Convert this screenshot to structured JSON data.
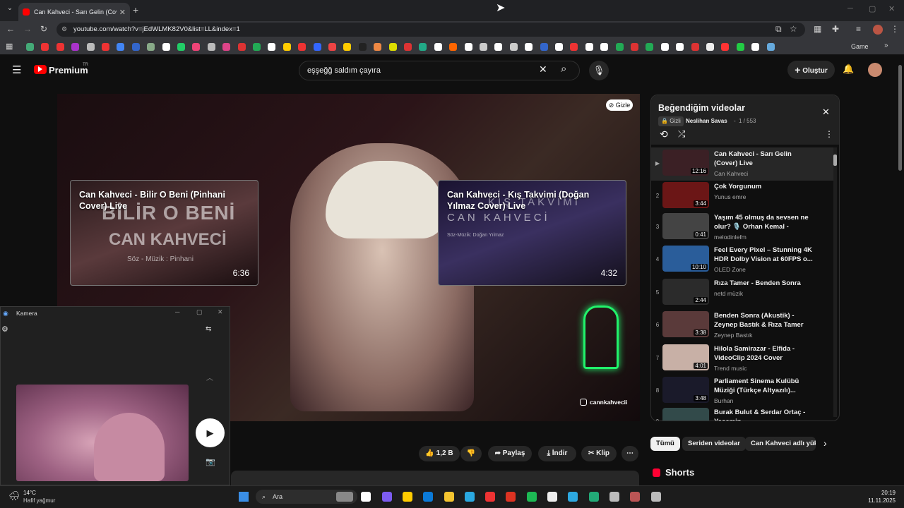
{
  "browser": {
    "tab_title": "Can Kahveci - Sarı Gelin (Cover)",
    "url": "youtube.com/watch?v=jEdWLMK82V0&list=LL&index=1",
    "bookmark_last": "Game"
  },
  "header": {
    "brand": "Premium",
    "brand_sup": "TR",
    "search_value": "eşşeğğ saldım çayıra",
    "create_label": "Oluştur"
  },
  "video": {
    "hide_label": "Gizle",
    "instagram": "cannkahvecii",
    "endcards": [
      {
        "title": "Can Kahveci - Bilir O Beni (Pinhani Cover) Live",
        "duration": "6:36",
        "overlay": "BİLİR O BENİ",
        "overlay2": "CAN KAHVECİ",
        "overlay3": "Söz - Müzik : Pinhani"
      },
      {
        "title": "Can Kahveci - Kış Takvimi (Doğan Yılmaz Cover) Live",
        "duration": "4:32",
        "overlay": "KIŞ TAKVİMİ",
        "overlay2": "CAN KAHVECİ",
        "overlay3": "Söz-Müzik: Doğan Yılmaz"
      }
    ]
  },
  "actions": {
    "likes": "1,2 B",
    "share": "Paylaş",
    "download": "İndir",
    "clip": "Klip"
  },
  "playlist": {
    "title": "Beğendiğim videolar",
    "privacy": "Gizli",
    "owner": "Neslihan Savas",
    "position": "1 / 553",
    "items": [
      {
        "n": "▶",
        "title": "Can Kahveci - Sarı Gelin (Cover) Live",
        "channel": "Can Kahveci",
        "duration": "12:16",
        "thumb": "#3b2025"
      },
      {
        "n": "2",
        "title": "Çok Yorgunum",
        "channel": "Yunus emre",
        "duration": "3:44",
        "thumb": "#6b1616"
      },
      {
        "n": "3",
        "title": "Yaşım 45 olmuş da sevsen ne olur? 🎙️ Orhan Kemal - Yaşım...",
        "channel": "melodinlefm",
        "duration": "0:41",
        "thumb": "#444"
      },
      {
        "n": "4",
        "title": "Feel Every Pixel – Stunning 4K HDR Dolby Vision at 60FPS o...",
        "channel": "OLED Zone",
        "duration": "10:10",
        "thumb": "#2a5d9a"
      },
      {
        "n": "5",
        "title": "Rıza Tamer - Benden Sonra",
        "channel": "netd müzik",
        "duration": "2:44",
        "thumb": "#2b2b2b"
      },
      {
        "n": "6",
        "title": "Benden Sonra (Akustik) - Zeynep Bastık & Rıza Tamer",
        "channel": "Zeynep Bastık",
        "duration": "3:38",
        "thumb": "#5a3a3a"
      },
      {
        "n": "7",
        "title": "Hilola Samirazar - Elfida - VideoClip 2024 Cover",
        "channel": "Trend music",
        "duration": "4:01",
        "thumb": "#c8b0a6"
      },
      {
        "n": "8",
        "title": "Parliament Sinema Kulübü Müziği (Türkçe Altyazılı)...",
        "channel": "Burhan",
        "duration": "3:48",
        "thumb": "#1a1a2a"
      },
      {
        "n": "9",
        "title": "Burak Bulut & Serdar Ortaç - Yasemin",
        "channel": "",
        "duration": "",
        "thumb": "#324a4a"
      }
    ]
  },
  "chips": [
    "Tümü",
    "Seriden videolar",
    "Can Kahveci adlı yükle"
  ],
  "shorts_label": "Shorts",
  "camera": {
    "title": "Kamera"
  },
  "taskbar": {
    "weather_temp": "14°C",
    "weather_desc": "Hafif yağmur",
    "search": "Ara",
    "time": "20:19",
    "date": "11.11.2025"
  }
}
